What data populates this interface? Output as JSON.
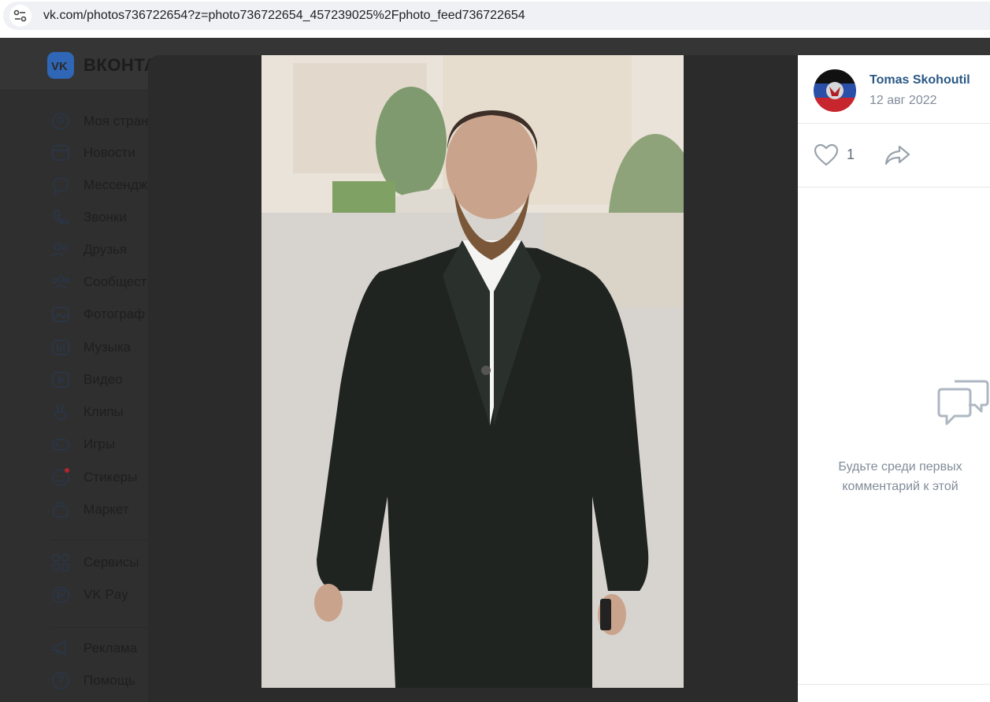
{
  "browser": {
    "url": "vk.com/photos736722654?z=photo736722654_457239025%2Fphoto_feed736722654"
  },
  "vk": {
    "logo_text": "ВКОНТА",
    "sidebar": [
      {
        "label": "Моя стран",
        "icon": "profile-icon"
      },
      {
        "label": "Новости",
        "icon": "news-icon"
      },
      {
        "label": "Мессендж",
        "icon": "messenger-icon"
      },
      {
        "label": "Звонки",
        "icon": "phone-icon"
      },
      {
        "label": "Друзья",
        "icon": "friends-icon"
      },
      {
        "label": "Сообщест",
        "icon": "communities-icon"
      },
      {
        "label": "Фотограф",
        "icon": "photos-icon"
      },
      {
        "label": "Музыка",
        "icon": "music-icon"
      },
      {
        "label": "Видео",
        "icon": "video-icon"
      },
      {
        "label": "Клипы",
        "icon": "clips-icon"
      },
      {
        "label": "Игры",
        "icon": "games-icon"
      },
      {
        "label": "Стикеры",
        "icon": "stickers-icon"
      },
      {
        "label": "Маркет",
        "icon": "market-icon"
      },
      {
        "label": "Сервисы",
        "icon": "services-icon"
      },
      {
        "label": "VK Pay",
        "icon": "vkpay-icon"
      },
      {
        "label": "Реклама",
        "icon": "ads-icon"
      },
      {
        "label": "Помощь",
        "icon": "help-icon"
      }
    ]
  },
  "viewer": {
    "author": "Tomas Skohoutil",
    "date": "12 авг 2022",
    "likes": "1",
    "empty_comments_line1": "Будьте среди первых",
    "empty_comments_line2": "комментарий к этой"
  },
  "colors": {
    "vk_blue": "#2f66b5",
    "author_link": "#2a5885",
    "muted_text": "#818c99"
  }
}
